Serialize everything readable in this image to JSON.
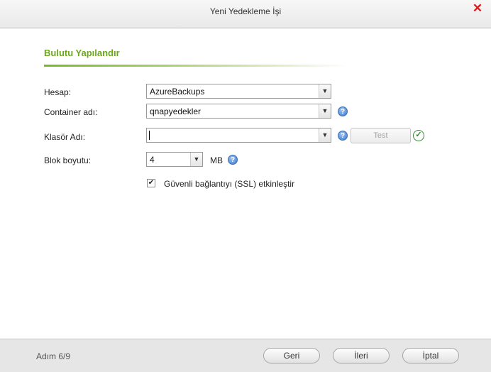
{
  "window": {
    "title": "Yeni Yedekleme İşi",
    "close_glyph": "✕"
  },
  "section": {
    "title": "Bulutu Yapılandır"
  },
  "form": {
    "account_label": "Hesap:",
    "account_value": "AzureBackups",
    "container_label": "Container adı:",
    "container_value": "qnapyedekler",
    "folder_label": "Klasör Adı:",
    "folder_value": "",
    "test_button": "Test",
    "block_size_label": "Blok boyutu:",
    "block_size_value": "4",
    "block_size_unit": "MB",
    "ssl_label": "Güvenli bağlantıyı (SSL) etkinleştir",
    "ssl_checked": true
  },
  "footer": {
    "step": "Adım 6/9",
    "back": "Geri",
    "next": "İleri",
    "cancel": "İptal"
  },
  "colors": {
    "section_title": "#6aa81a",
    "close": "#e0191f",
    "help": "#3f79c9",
    "ok": "#2f8c2f"
  },
  "icons": [
    "close-icon",
    "chevron-down-icon",
    "help-icon",
    "check-circle-icon",
    "checkbox-checked-icon"
  ]
}
